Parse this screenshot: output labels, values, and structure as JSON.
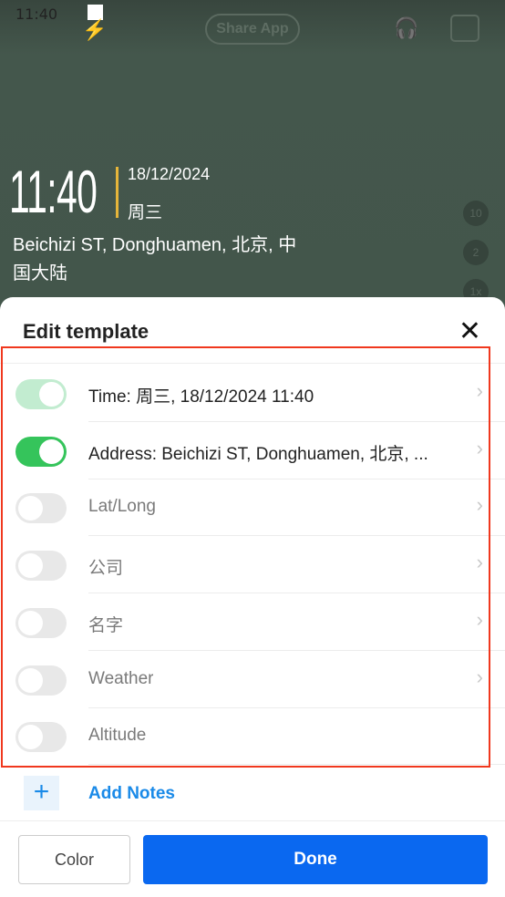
{
  "status_bar": {
    "time": "11:40"
  },
  "background": {
    "share_label": "Share App",
    "clock": "11:40",
    "date": "18/12/2024",
    "weekday": "周三",
    "address": "Beichizi ST, Donghuamen, 北京, 中国大陆",
    "side_buttons": [
      "10",
      "2",
      "1x"
    ]
  },
  "sheet": {
    "title": "Edit template",
    "items": [
      {
        "label": "Time: 周三, 18/12/2024 11:40",
        "state": "on-disabled",
        "chevron": true
      },
      {
        "label": "Address: Beichizi ST, Donghuamen, 北京, ...",
        "state": "on",
        "chevron": true
      },
      {
        "label": "Lat/Long",
        "state": "off",
        "chevron": true
      },
      {
        "label": "公司",
        "state": "off",
        "chevron": true
      },
      {
        "label": "名字",
        "state": "off",
        "chevron": true
      },
      {
        "label": "Weather",
        "state": "off",
        "chevron": true
      },
      {
        "label": "Altitude",
        "state": "off",
        "chevron": false
      }
    ],
    "add_notes": "Add Notes",
    "color_label": "Color",
    "done_label": "Done"
  },
  "colors": {
    "accent": "#0a68f0",
    "toggle_on": "#35c45b",
    "highlight": "#f0381e"
  }
}
